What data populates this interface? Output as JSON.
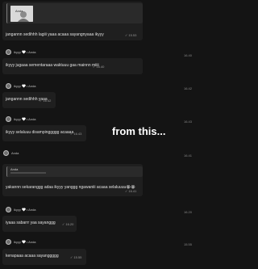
{
  "center_overlay": "from this...",
  "messages": [
    {
      "type": "quoted-photo",
      "quote_name": "Anda",
      "text": "jangannn sedihhh lagiii yaaa acaaa sayangnyaaa ikyyy",
      "time": "15.53",
      "row_time": ""
    },
    {
      "sender": "ikyyy",
      "sender_suffix": "• Anda",
      "text": "ikyyy jugaaa sementaraaa waktuuu gaa mainnn miiii",
      "time": "16.40",
      "row_time": "16.40"
    },
    {
      "sender": "ikyyy",
      "sender_suffix": "• Anda",
      "text": "jangannn sedihhh yaaa",
      "time": "16.42",
      "row_time": "16.42"
    },
    {
      "sender": "ikyyy",
      "sender_suffix": "• Anda",
      "text": "ikyyy selaluuu disampinggggg acaaaa",
      "time": "16.43",
      "row_time": "16.43"
    },
    {
      "type": "quoted-text",
      "quote_name": "Anda",
      "text": "yakannn sekaranggg adaa ikyyy yanggg ngawaniii acaaa selaluuuu😭😭",
      "time": "16.41",
      "row_time": "16.41"
    },
    {
      "sender": "ikyyy",
      "sender_suffix": "• Anda",
      "text": "iyaaa sabarrr yaa sayanggg",
      "time": "16.20",
      "row_time": "16.20"
    },
    {
      "sender": "ikyyy",
      "sender_suffix": "• Anda",
      "text": "kenapaaa acaaa sayanggggg",
      "time": "15.55",
      "row_time": "15.55"
    }
  ]
}
